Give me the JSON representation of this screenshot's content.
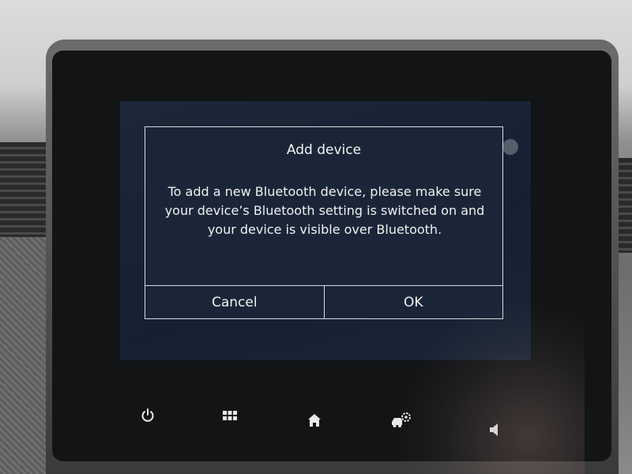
{
  "dialog": {
    "title": "Add device",
    "message_lines": [
      "To add a new Bluetooth device, please make sure",
      "your device’s Bluetooth setting is switched on and",
      "your device is visible over Bluetooth."
    ],
    "cancel_label": "Cancel",
    "ok_label": "OK"
  },
  "nav_bar": {
    "icons": [
      "power-icon",
      "apps-grid-icon",
      "home-icon",
      "vehicle-settings-icon",
      "volume-icon"
    ]
  },
  "colors": {
    "dialog_border": "#d8dbe0",
    "screen_background": "#1a2638",
    "text": "#f2f2f2"
  }
}
